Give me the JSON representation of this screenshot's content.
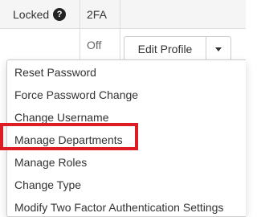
{
  "table": {
    "headers": {
      "locked": "Locked",
      "locked_help_icon": "?",
      "two_fa": "2FA"
    },
    "row": {
      "two_fa_value": "Off"
    }
  },
  "actions": {
    "edit_profile_label": "Edit Profile",
    "caret_icon": "caret-down-icon"
  },
  "menu": {
    "items": [
      {
        "label": "Reset Password"
      },
      {
        "label": "Force Password Change"
      },
      {
        "label": "Change Username"
      },
      {
        "label": "Manage Departments",
        "highlighted": true
      },
      {
        "label": "Manage Roles"
      },
      {
        "label": "Change Type"
      },
      {
        "label": "Modify Two Factor Authentication Settings"
      }
    ]
  },
  "colors": {
    "highlight_border": "#dd1c23",
    "header_background": "#f5f5f5",
    "help_icon_background": "#222222"
  }
}
